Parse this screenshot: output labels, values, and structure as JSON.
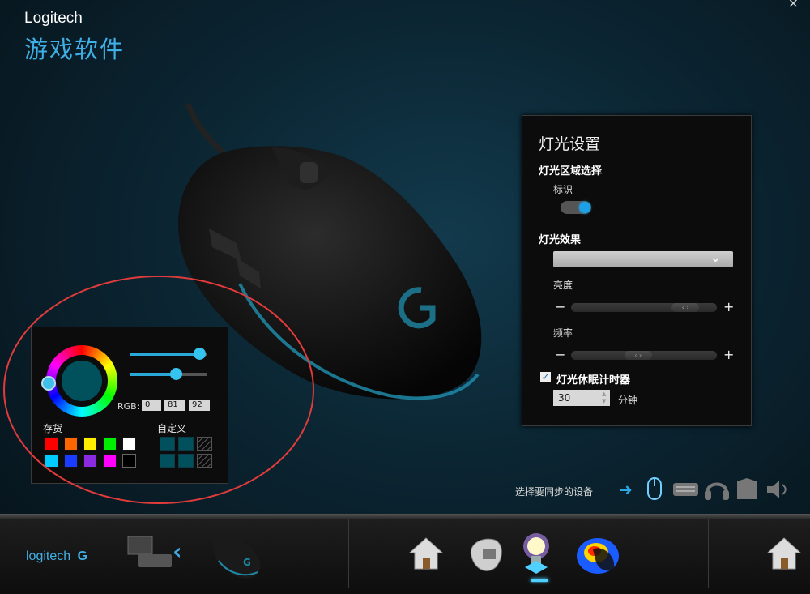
{
  "header": {
    "brand": "Logitech",
    "app_title": "游戏软件",
    "close_glyph": "×"
  },
  "lighting": {
    "title": "灯光设置",
    "zone_section": "灯光区域选择",
    "zone_label": "标识",
    "zone_enabled": true,
    "effect_section": "灯光效果",
    "effect_value": "",
    "brightness_label": "亮度",
    "brightness_level": 0.85,
    "rate_label": "频率",
    "rate_level": 0.45,
    "minus": "−",
    "plus": "+",
    "sleep_timer_label": "灯光休眠计时器",
    "sleep_timer_checked": true,
    "sleep_timer_value": "30",
    "sleep_timer_unit": "分钟"
  },
  "color_picker": {
    "selected_color": "#00515c",
    "slider1_level": 0.9,
    "slider2_level": 0.6,
    "rgb_label": "RGB:",
    "rgb": [
      "0",
      "81",
      "92"
    ],
    "stock_label": "存货",
    "custom_label": "自定义",
    "stock_colors": [
      "#ff0000",
      "#ff6600",
      "#ffee00",
      "#00ee00",
      "#ffffff",
      "#00ccff",
      "#1a3cff",
      "#8a2be2",
      "#ff00ff",
      "#000000"
    ],
    "custom_colors": [
      "#00515c",
      "#00515c",
      "empty",
      "#00515c",
      "#00515c",
      "empty"
    ]
  },
  "sync": {
    "label": "选择要同步的设备",
    "devices": [
      "mouse-icon",
      "keyboard-icon",
      "headset-icon",
      "speaker-box-icon",
      "speaker-icon"
    ]
  },
  "bottom_bar": {
    "logo_text": "logitech",
    "back_glyph": "‹",
    "nav": [
      "home-icon",
      "customize-buttons-icon",
      "lighting-icon",
      "heatmap-icon",
      "home-icon"
    ]
  }
}
